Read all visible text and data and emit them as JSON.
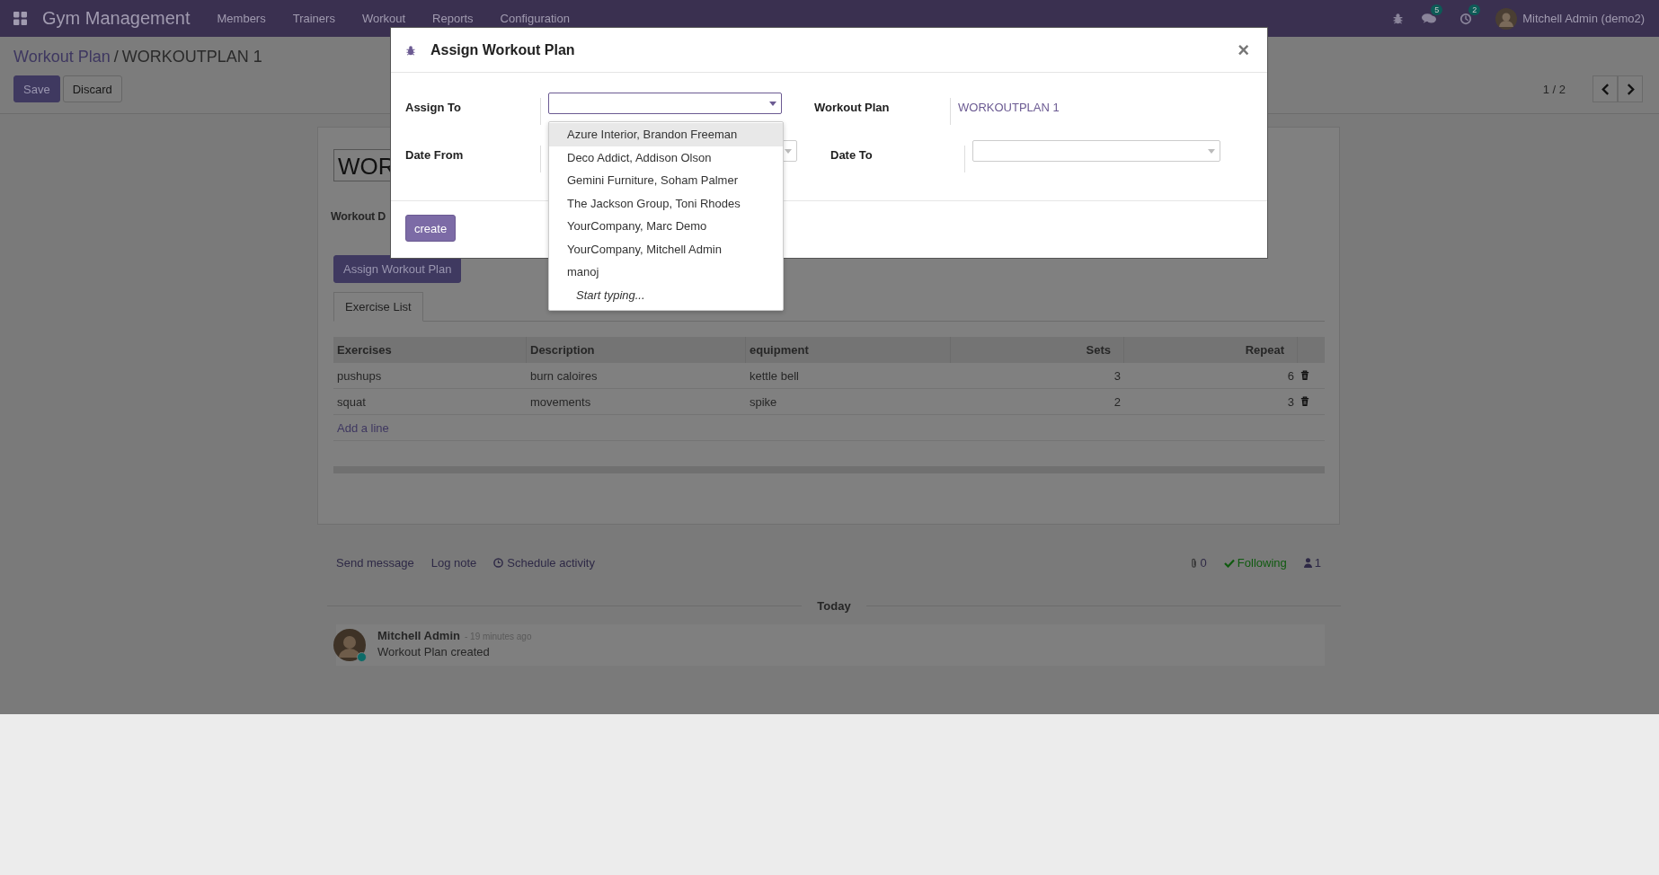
{
  "navbar": {
    "app_name": "Gym Management",
    "menu": [
      "Members",
      "Trainers",
      "Workout",
      "Reports",
      "Configuration"
    ],
    "messages_badge": "5",
    "activities_badge": "2",
    "user": "Mitchell Admin (demo2)"
  },
  "breadcrumb": {
    "parent": "Workout Plan",
    "separator": "/",
    "current": "WORKOUTPLAN 1"
  },
  "actions": [
    {
      "label": "Save",
      "kind": "primary"
    },
    {
      "label": "Discard",
      "kind": "secondary"
    }
  ],
  "pager": "1 / 2",
  "form": {
    "title_value": "WOR",
    "field_label": "Workout D",
    "assign_button": "Assign Workout Plan",
    "tabs": [
      {
        "label": "Exercise List",
        "selected": true
      }
    ],
    "table": {
      "columns": [
        "Exercises",
        "Description",
        "equipment",
        "Sets",
        "Repeat"
      ],
      "rows": [
        [
          "pushups",
          "burn caloires",
          "kettle bell",
          "3",
          "6"
        ],
        [
          "squat",
          "movements",
          "spike",
          "2",
          "3"
        ]
      ],
      "add_line": "Add a line"
    }
  },
  "chatter": {
    "actions": [
      {
        "label": "Send message",
        "kind": "text"
      },
      {
        "label": "Log note",
        "kind": "text"
      },
      {
        "label": "Schedule activity",
        "kind": "clock"
      }
    ],
    "attachments": "0",
    "follow": "Following",
    "followers": "1",
    "separator": "Today",
    "messages": [
      {
        "author": "Mitchell Admin",
        "time": "- 19 minutes ago",
        "body": "Workout Plan created",
        "online": true
      }
    ]
  },
  "dialog": {
    "title": "Assign Workout Plan",
    "close": "×",
    "assign_to_label": "Assign To",
    "plan_label": "Workout Plan",
    "plan_value": "WORKOUTPLAN 1",
    "date_from_label": "Date From",
    "date_to_label": "Date To",
    "create_button": "create",
    "dropdown": {
      "options": [
        {
          "label": "Azure Interior, Brandon Freeman",
          "selected": true
        },
        {
          "label": "Deco Addict, Addison Olson",
          "selected": false
        },
        {
          "label": "Gemini Furniture, Soham Palmer",
          "selected": false
        },
        {
          "label": "The Jackson Group, Toni Rhodes",
          "selected": false
        },
        {
          "label": "YourCompany, Marc Demo",
          "selected": false
        },
        {
          "label": "YourCompany, Mitchell Admin",
          "selected": false
        },
        {
          "label": "manoj",
          "selected": false
        }
      ],
      "hint": "Start typing..."
    }
  }
}
